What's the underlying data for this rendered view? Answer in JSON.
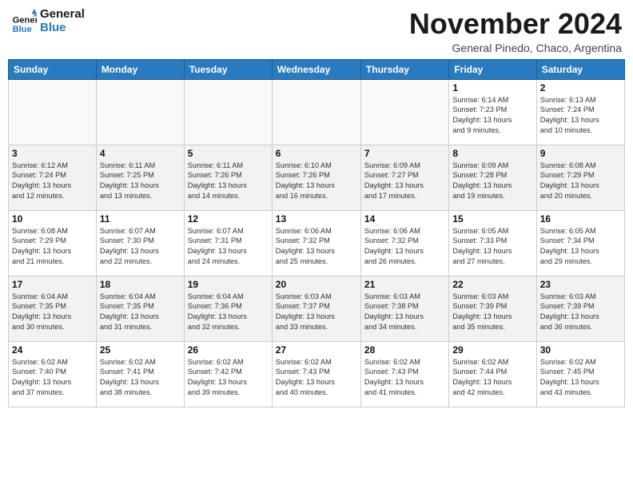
{
  "header": {
    "logo_line1": "General",
    "logo_line2": "Blue",
    "month": "November 2024",
    "location": "General Pinedo, Chaco, Argentina"
  },
  "weekdays": [
    "Sunday",
    "Monday",
    "Tuesday",
    "Wednesday",
    "Thursday",
    "Friday",
    "Saturday"
  ],
  "weeks": [
    [
      {
        "day": "",
        "info": ""
      },
      {
        "day": "",
        "info": ""
      },
      {
        "day": "",
        "info": ""
      },
      {
        "day": "",
        "info": ""
      },
      {
        "day": "",
        "info": ""
      },
      {
        "day": "1",
        "info": "Sunrise: 6:14 AM\nSunset: 7:23 PM\nDaylight: 13 hours\nand 9 minutes."
      },
      {
        "day": "2",
        "info": "Sunrise: 6:13 AM\nSunset: 7:24 PM\nDaylight: 13 hours\nand 10 minutes."
      }
    ],
    [
      {
        "day": "3",
        "info": "Sunrise: 6:12 AM\nSunset: 7:24 PM\nDaylight: 13 hours\nand 12 minutes."
      },
      {
        "day": "4",
        "info": "Sunrise: 6:11 AM\nSunset: 7:25 PM\nDaylight: 13 hours\nand 13 minutes."
      },
      {
        "day": "5",
        "info": "Sunrise: 6:11 AM\nSunset: 7:26 PM\nDaylight: 13 hours\nand 14 minutes."
      },
      {
        "day": "6",
        "info": "Sunrise: 6:10 AM\nSunset: 7:26 PM\nDaylight: 13 hours\nand 16 minutes."
      },
      {
        "day": "7",
        "info": "Sunrise: 6:09 AM\nSunset: 7:27 PM\nDaylight: 13 hours\nand 17 minutes."
      },
      {
        "day": "8",
        "info": "Sunrise: 6:09 AM\nSunset: 7:28 PM\nDaylight: 13 hours\nand 19 minutes."
      },
      {
        "day": "9",
        "info": "Sunrise: 6:08 AM\nSunset: 7:29 PM\nDaylight: 13 hours\nand 20 minutes."
      }
    ],
    [
      {
        "day": "10",
        "info": "Sunrise: 6:08 AM\nSunset: 7:29 PM\nDaylight: 13 hours\nand 21 minutes."
      },
      {
        "day": "11",
        "info": "Sunrise: 6:07 AM\nSunset: 7:30 PM\nDaylight: 13 hours\nand 22 minutes."
      },
      {
        "day": "12",
        "info": "Sunrise: 6:07 AM\nSunset: 7:31 PM\nDaylight: 13 hours\nand 24 minutes."
      },
      {
        "day": "13",
        "info": "Sunrise: 6:06 AM\nSunset: 7:32 PM\nDaylight: 13 hours\nand 25 minutes."
      },
      {
        "day": "14",
        "info": "Sunrise: 6:06 AM\nSunset: 7:32 PM\nDaylight: 13 hours\nand 26 minutes."
      },
      {
        "day": "15",
        "info": "Sunrise: 6:05 AM\nSunset: 7:33 PM\nDaylight: 13 hours\nand 27 minutes."
      },
      {
        "day": "16",
        "info": "Sunrise: 6:05 AM\nSunset: 7:34 PM\nDaylight: 13 hours\nand 29 minutes."
      }
    ],
    [
      {
        "day": "17",
        "info": "Sunrise: 6:04 AM\nSunset: 7:35 PM\nDaylight: 13 hours\nand 30 minutes."
      },
      {
        "day": "18",
        "info": "Sunrise: 6:04 AM\nSunset: 7:35 PM\nDaylight: 13 hours\nand 31 minutes."
      },
      {
        "day": "19",
        "info": "Sunrise: 6:04 AM\nSunset: 7:36 PM\nDaylight: 13 hours\nand 32 minutes."
      },
      {
        "day": "20",
        "info": "Sunrise: 6:03 AM\nSunset: 7:37 PM\nDaylight: 13 hours\nand 33 minutes."
      },
      {
        "day": "21",
        "info": "Sunrise: 6:03 AM\nSunset: 7:38 PM\nDaylight: 13 hours\nand 34 minutes."
      },
      {
        "day": "22",
        "info": "Sunrise: 6:03 AM\nSunset: 7:39 PM\nDaylight: 13 hours\nand 35 minutes."
      },
      {
        "day": "23",
        "info": "Sunrise: 6:03 AM\nSunset: 7:39 PM\nDaylight: 13 hours\nand 36 minutes."
      }
    ],
    [
      {
        "day": "24",
        "info": "Sunrise: 6:02 AM\nSunset: 7:40 PM\nDaylight: 13 hours\nand 37 minutes."
      },
      {
        "day": "25",
        "info": "Sunrise: 6:02 AM\nSunset: 7:41 PM\nDaylight: 13 hours\nand 38 minutes."
      },
      {
        "day": "26",
        "info": "Sunrise: 6:02 AM\nSunset: 7:42 PM\nDaylight: 13 hours\nand 39 minutes."
      },
      {
        "day": "27",
        "info": "Sunrise: 6:02 AM\nSunset: 7:43 PM\nDaylight: 13 hours\nand 40 minutes."
      },
      {
        "day": "28",
        "info": "Sunrise: 6:02 AM\nSunset: 7:43 PM\nDaylight: 13 hours\nand 41 minutes."
      },
      {
        "day": "29",
        "info": "Sunrise: 6:02 AM\nSunset: 7:44 PM\nDaylight: 13 hours\nand 42 minutes."
      },
      {
        "day": "30",
        "info": "Sunrise: 6:02 AM\nSunset: 7:45 PM\nDaylight: 13 hours\nand 43 minutes."
      }
    ]
  ]
}
